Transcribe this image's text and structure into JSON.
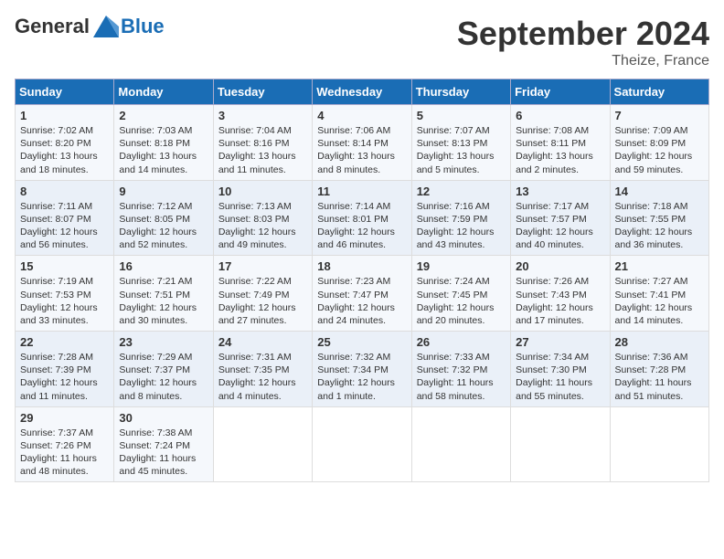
{
  "header": {
    "logo_general": "General",
    "logo_blue": "Blue",
    "month": "September 2024",
    "location": "Theize, France"
  },
  "days_of_week": [
    "Sunday",
    "Monday",
    "Tuesday",
    "Wednesday",
    "Thursday",
    "Friday",
    "Saturday"
  ],
  "weeks": [
    [
      {
        "day": "1",
        "lines": [
          "Sunrise: 7:02 AM",
          "Sunset: 8:20 PM",
          "Daylight: 13 hours",
          "and 18 minutes."
        ]
      },
      {
        "day": "2",
        "lines": [
          "Sunrise: 7:03 AM",
          "Sunset: 8:18 PM",
          "Daylight: 13 hours",
          "and 14 minutes."
        ]
      },
      {
        "day": "3",
        "lines": [
          "Sunrise: 7:04 AM",
          "Sunset: 8:16 PM",
          "Daylight: 13 hours",
          "and 11 minutes."
        ]
      },
      {
        "day": "4",
        "lines": [
          "Sunrise: 7:06 AM",
          "Sunset: 8:14 PM",
          "Daylight: 13 hours",
          "and 8 minutes."
        ]
      },
      {
        "day": "5",
        "lines": [
          "Sunrise: 7:07 AM",
          "Sunset: 8:13 PM",
          "Daylight: 13 hours",
          "and 5 minutes."
        ]
      },
      {
        "day": "6",
        "lines": [
          "Sunrise: 7:08 AM",
          "Sunset: 8:11 PM",
          "Daylight: 13 hours",
          "and 2 minutes."
        ]
      },
      {
        "day": "7",
        "lines": [
          "Sunrise: 7:09 AM",
          "Sunset: 8:09 PM",
          "Daylight: 12 hours",
          "and 59 minutes."
        ]
      }
    ],
    [
      {
        "day": "8",
        "lines": [
          "Sunrise: 7:11 AM",
          "Sunset: 8:07 PM",
          "Daylight: 12 hours",
          "and 56 minutes."
        ]
      },
      {
        "day": "9",
        "lines": [
          "Sunrise: 7:12 AM",
          "Sunset: 8:05 PM",
          "Daylight: 12 hours",
          "and 52 minutes."
        ]
      },
      {
        "day": "10",
        "lines": [
          "Sunrise: 7:13 AM",
          "Sunset: 8:03 PM",
          "Daylight: 12 hours",
          "and 49 minutes."
        ]
      },
      {
        "day": "11",
        "lines": [
          "Sunrise: 7:14 AM",
          "Sunset: 8:01 PM",
          "Daylight: 12 hours",
          "and 46 minutes."
        ]
      },
      {
        "day": "12",
        "lines": [
          "Sunrise: 7:16 AM",
          "Sunset: 7:59 PM",
          "Daylight: 12 hours",
          "and 43 minutes."
        ]
      },
      {
        "day": "13",
        "lines": [
          "Sunrise: 7:17 AM",
          "Sunset: 7:57 PM",
          "Daylight: 12 hours",
          "and 40 minutes."
        ]
      },
      {
        "day": "14",
        "lines": [
          "Sunrise: 7:18 AM",
          "Sunset: 7:55 PM",
          "Daylight: 12 hours",
          "and 36 minutes."
        ]
      }
    ],
    [
      {
        "day": "15",
        "lines": [
          "Sunrise: 7:19 AM",
          "Sunset: 7:53 PM",
          "Daylight: 12 hours",
          "and 33 minutes."
        ]
      },
      {
        "day": "16",
        "lines": [
          "Sunrise: 7:21 AM",
          "Sunset: 7:51 PM",
          "Daylight: 12 hours",
          "and 30 minutes."
        ]
      },
      {
        "day": "17",
        "lines": [
          "Sunrise: 7:22 AM",
          "Sunset: 7:49 PM",
          "Daylight: 12 hours",
          "and 27 minutes."
        ]
      },
      {
        "day": "18",
        "lines": [
          "Sunrise: 7:23 AM",
          "Sunset: 7:47 PM",
          "Daylight: 12 hours",
          "and 24 minutes."
        ]
      },
      {
        "day": "19",
        "lines": [
          "Sunrise: 7:24 AM",
          "Sunset: 7:45 PM",
          "Daylight: 12 hours",
          "and 20 minutes."
        ]
      },
      {
        "day": "20",
        "lines": [
          "Sunrise: 7:26 AM",
          "Sunset: 7:43 PM",
          "Daylight: 12 hours",
          "and 17 minutes."
        ]
      },
      {
        "day": "21",
        "lines": [
          "Sunrise: 7:27 AM",
          "Sunset: 7:41 PM",
          "Daylight: 12 hours",
          "and 14 minutes."
        ]
      }
    ],
    [
      {
        "day": "22",
        "lines": [
          "Sunrise: 7:28 AM",
          "Sunset: 7:39 PM",
          "Daylight: 12 hours",
          "and 11 minutes."
        ]
      },
      {
        "day": "23",
        "lines": [
          "Sunrise: 7:29 AM",
          "Sunset: 7:37 PM",
          "Daylight: 12 hours",
          "and 8 minutes."
        ]
      },
      {
        "day": "24",
        "lines": [
          "Sunrise: 7:31 AM",
          "Sunset: 7:35 PM",
          "Daylight: 12 hours",
          "and 4 minutes."
        ]
      },
      {
        "day": "25",
        "lines": [
          "Sunrise: 7:32 AM",
          "Sunset: 7:34 PM",
          "Daylight: 12 hours",
          "and 1 minute."
        ]
      },
      {
        "day": "26",
        "lines": [
          "Sunrise: 7:33 AM",
          "Sunset: 7:32 PM",
          "Daylight: 11 hours",
          "and 58 minutes."
        ]
      },
      {
        "day": "27",
        "lines": [
          "Sunrise: 7:34 AM",
          "Sunset: 7:30 PM",
          "Daylight: 11 hours",
          "and 55 minutes."
        ]
      },
      {
        "day": "28",
        "lines": [
          "Sunrise: 7:36 AM",
          "Sunset: 7:28 PM",
          "Daylight: 11 hours",
          "and 51 minutes."
        ]
      }
    ],
    [
      {
        "day": "29",
        "lines": [
          "Sunrise: 7:37 AM",
          "Sunset: 7:26 PM",
          "Daylight: 11 hours",
          "and 48 minutes."
        ]
      },
      {
        "day": "30",
        "lines": [
          "Sunrise: 7:38 AM",
          "Sunset: 7:24 PM",
          "Daylight: 11 hours",
          "and 45 minutes."
        ]
      },
      null,
      null,
      null,
      null,
      null
    ]
  ]
}
